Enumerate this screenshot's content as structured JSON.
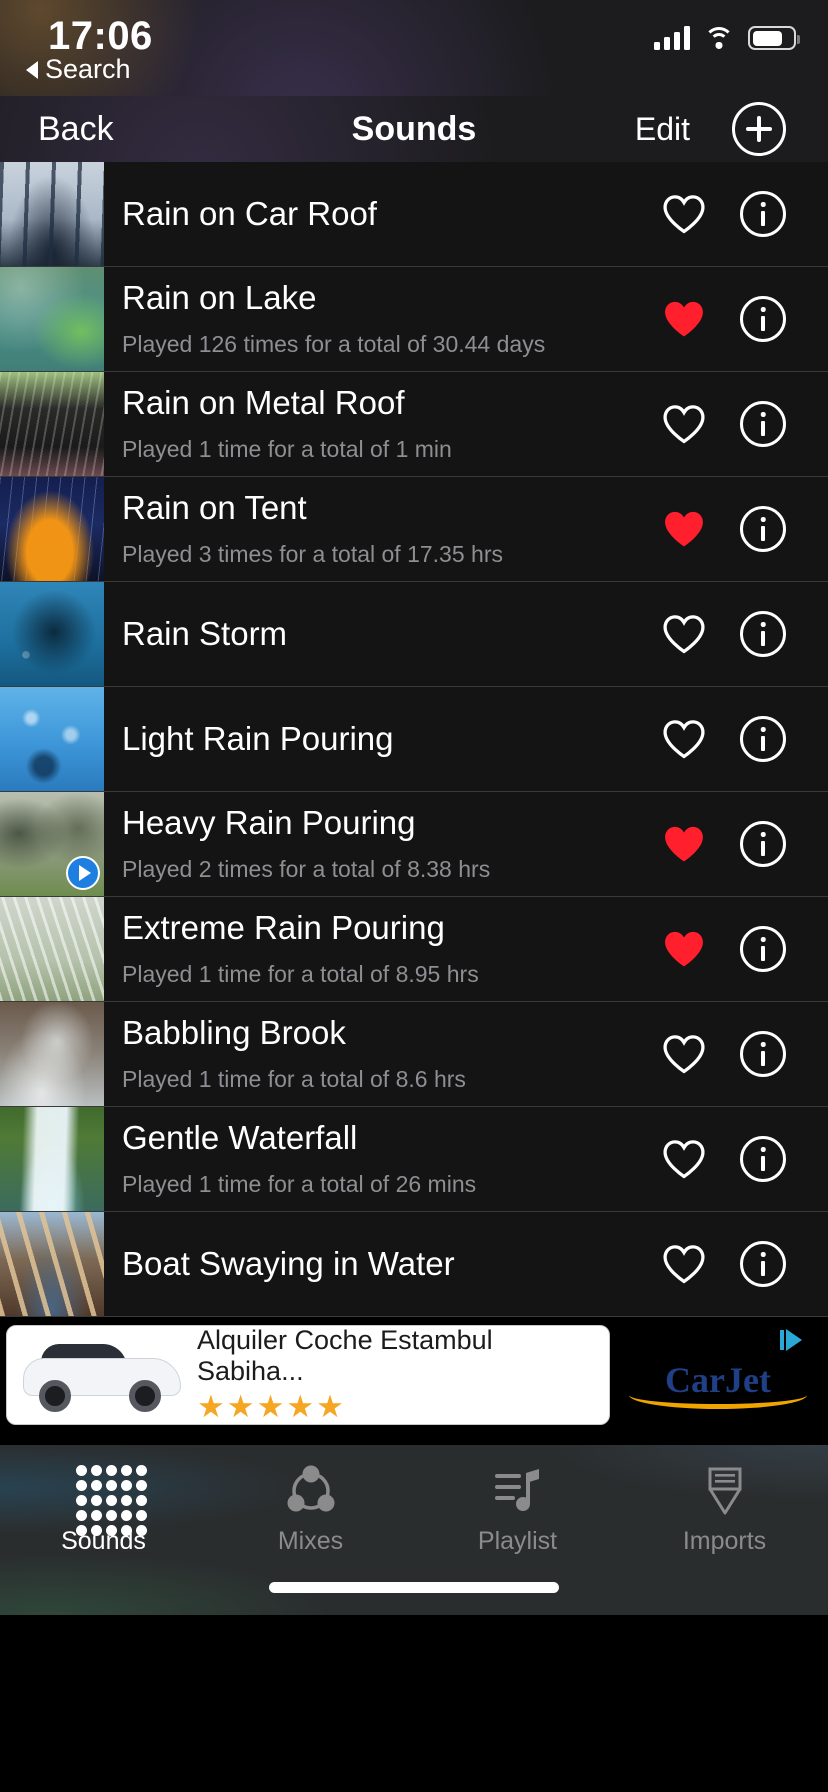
{
  "status_bar": {
    "time": "17:06",
    "back_to_app": "Search",
    "signal_icon": "cellular-signal-icon",
    "wifi_icon": "wifi-icon",
    "battery_icon": "battery-icon"
  },
  "nav_bar": {
    "back_label": "Back",
    "title": "Sounds",
    "edit_label": "Edit",
    "add_icon": "plus-circle-icon"
  },
  "colors": {
    "favorite_red": "#ff1f2d",
    "screen_background": "#111111",
    "row_background": "#141414",
    "accent_blue": "#1e7fe0",
    "subtitle_gray": "#8e8e93"
  },
  "sounds": [
    {
      "title": "Rain on Car Roof",
      "subtitle": "",
      "favorite": false,
      "playing": false,
      "art": "art-carroof"
    },
    {
      "title": "Rain on Lake",
      "subtitle": "Played 126 times for a total of 30.44 days",
      "favorite": true,
      "playing": false,
      "art": "art-lake"
    },
    {
      "title": "Rain on Metal Roof",
      "subtitle": "Played 1 time for a total of 1 min",
      "favorite": false,
      "playing": false,
      "art": "art-metal"
    },
    {
      "title": "Rain on Tent",
      "subtitle": "Played 3 times for a total of 17.35 hrs",
      "favorite": true,
      "playing": false,
      "art": "art-tent"
    },
    {
      "title": "Rain Storm",
      "subtitle": "",
      "favorite": false,
      "playing": false,
      "art": "art-storm"
    },
    {
      "title": "Light Rain Pouring",
      "subtitle": "",
      "favorite": false,
      "playing": false,
      "art": "art-light"
    },
    {
      "title": "Heavy Rain Pouring",
      "subtitle": "Played 2 times for a total of 8.38 hrs",
      "favorite": true,
      "playing": true,
      "art": "art-heavy"
    },
    {
      "title": "Extreme Rain Pouring",
      "subtitle": "Played 1 time for a total of 8.95 hrs",
      "favorite": true,
      "playing": false,
      "art": "art-extreme"
    },
    {
      "title": "Babbling Brook",
      "subtitle": "Played 1 time for a total of 8.6 hrs",
      "favorite": false,
      "playing": false,
      "art": "art-brook"
    },
    {
      "title": "Gentle Waterfall",
      "subtitle": "Played 1 time for a total of 26 mins",
      "favorite": false,
      "playing": false,
      "art": "art-waterfall"
    },
    {
      "title": "Boat Swaying in Water",
      "subtitle": "",
      "favorite": false,
      "playing": false,
      "art": "art-boat"
    }
  ],
  "ad": {
    "headline": "Alquiler Coche Estambul Sabiha...",
    "rating_stars": "★★★★★",
    "brand": "CarJet",
    "adchoices_icon": "adchoices-icon",
    "car_image": "white-car-image"
  },
  "tab_bar": {
    "tabs": [
      {
        "label": "Sounds",
        "icon": "equalizer-dots-icon",
        "active": true
      },
      {
        "label": "Mixes",
        "icon": "mix-nodes-icon",
        "active": false
      },
      {
        "label": "Playlist",
        "icon": "playlist-note-icon",
        "active": false
      },
      {
        "label": "Imports",
        "icon": "import-download-icon",
        "active": false
      }
    ],
    "home_indicator": "home-indicator"
  }
}
